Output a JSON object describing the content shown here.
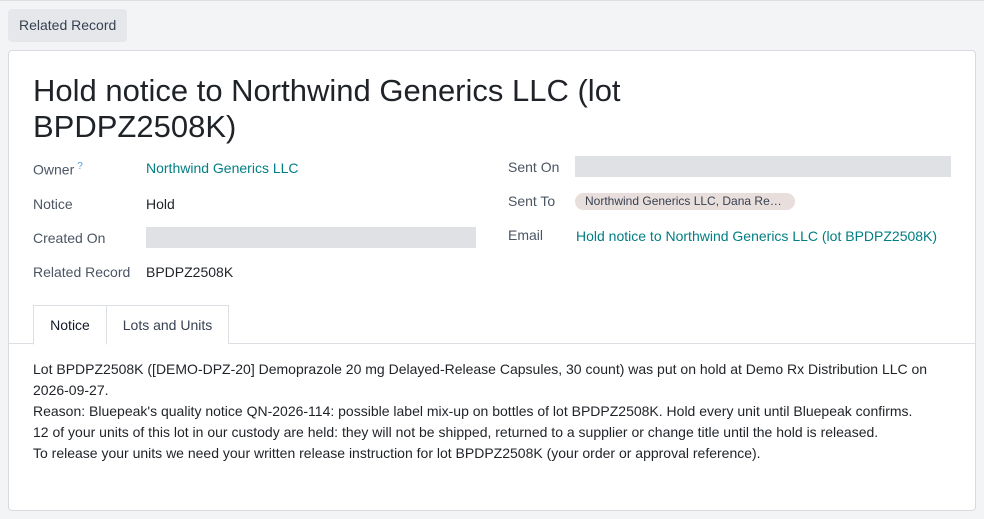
{
  "top_button": "Related Record",
  "record": {
    "title": "Hold notice to Northwind Generics LLC (lot BPDPZ2508K)"
  },
  "fields": {
    "owner_label": "Owner",
    "owner_help": "?",
    "owner_value": "Northwind Generics LLC",
    "notice_label": "Notice",
    "notice_value": "Hold",
    "created_on_label": "Created On",
    "related_record_label": "Related Record",
    "related_record_value": "BPDPZ2508K",
    "sent_on_label": "Sent On",
    "sent_to_label": "Sent To",
    "sent_to_tag": "Northwind Generics LLC, Dana Re…",
    "email_label": "Email",
    "email_value": "Hold notice to Northwind Generics LLC (lot BPDPZ2508K)"
  },
  "tabs": [
    "Notice",
    "Lots and Units"
  ],
  "notice_lines": [
    "Lot BPDPZ2508K ([DEMO-DPZ-20] Demoprazole 20 mg Delayed-Release Capsules, 30 count) was put on hold at Demo Rx Distribution LLC on 2026-09-27.",
    "Reason: Bluepeak's quality notice QN-2026-114: possible label mix-up on bottles of lot BPDPZ2508K. Hold every unit until Bluepeak confirms.",
    "12 of your units of this lot in our custody are held: they will not be shipped, returned to a supplier or change title until the hold is released.",
    "To release your units we need your written release instruction for lot BPDPZ2508K (your order or approval reference)."
  ]
}
